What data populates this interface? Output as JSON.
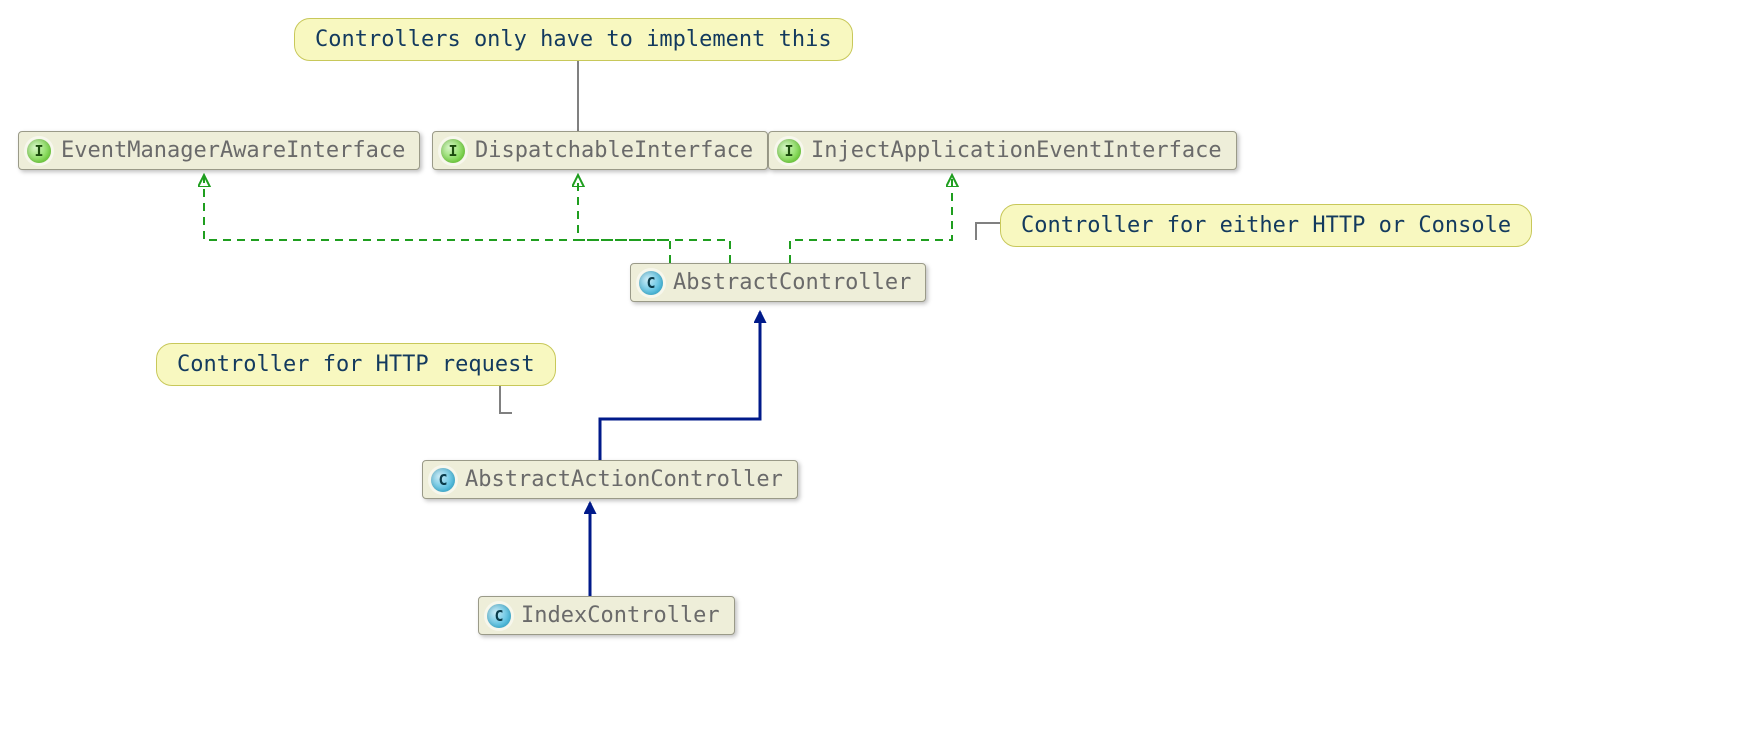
{
  "notes": {
    "top": "Controllers only have to implement this",
    "right": "Controller for either HTTP or Console",
    "left": "Controller for HTTP request"
  },
  "interfaces": {
    "eventManagerAware": "EventManagerAwareInterface",
    "dispatchable": "DispatchableInterface",
    "injectApplicationEvent": "InjectApplicationEventInterface"
  },
  "classes": {
    "abstractController": "AbstractController",
    "abstractActionController": "AbstractActionController",
    "indexController": "IndexController"
  },
  "badges": {
    "interface": "I",
    "class": "C"
  },
  "relations": {
    "implements": [
      {
        "from": "AbstractController",
        "to": "EventManagerAwareInterface"
      },
      {
        "from": "AbstractController",
        "to": "DispatchableInterface"
      },
      {
        "from": "AbstractController",
        "to": "InjectApplicationEventInterface"
      }
    ],
    "extends": [
      {
        "from": "AbstractActionController",
        "to": "AbstractController"
      },
      {
        "from": "IndexController",
        "to": "AbstractActionController"
      }
    ],
    "annotations": [
      {
        "note": "Controllers only have to implement this",
        "target": "DispatchableInterface"
      },
      {
        "note": "Controller for either HTTP or Console",
        "target": "AbstractController"
      },
      {
        "note": "Controller for HTTP request",
        "target": "AbstractActionController"
      }
    ]
  }
}
